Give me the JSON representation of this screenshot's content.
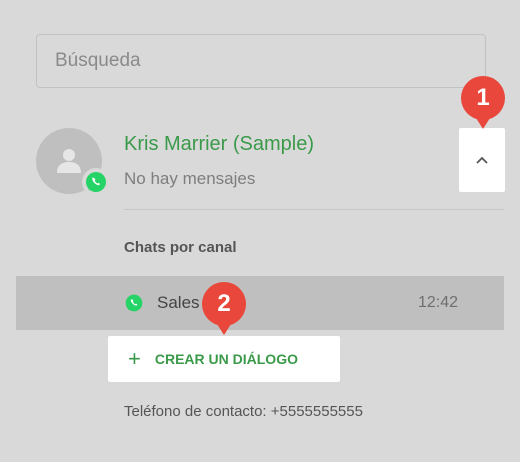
{
  "search": {
    "placeholder": "Búsqueda"
  },
  "contact": {
    "name": "Kris Marrier (Sample)",
    "status": "No hay mensajes"
  },
  "markers": {
    "first": "1",
    "second": "2"
  },
  "channels": {
    "title": "Chats por canal",
    "items": [
      {
        "name": "Sales",
        "time": "12:42",
        "icon": "whatsapp-icon"
      }
    ]
  },
  "actions": {
    "create_dialog_plus": "+",
    "create_dialog_label": "CREAR UN DIÁLOGO"
  },
  "footer": {
    "phone_text": "Teléfono de contacto: +5555555555"
  },
  "colors": {
    "accent_green": "#3b9a4a",
    "whatsapp_green": "#25d366",
    "marker_red": "#e9473b"
  }
}
